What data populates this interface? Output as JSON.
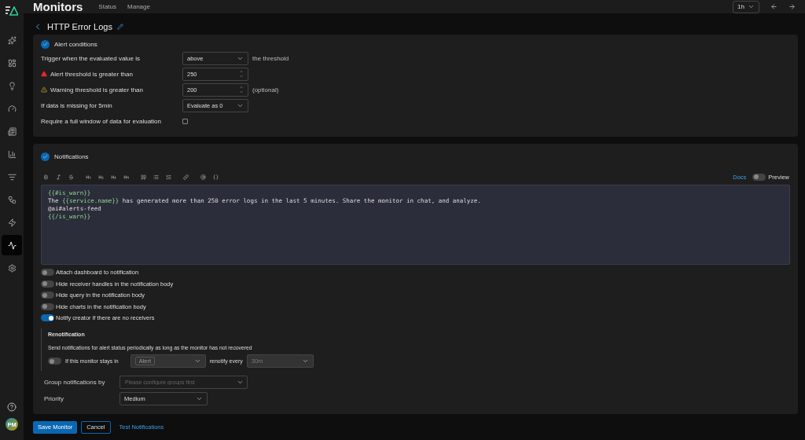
{
  "app": {
    "title": "Monitors",
    "nav": [
      {
        "label": "Status",
        "selected": false
      },
      {
        "label": "Manage",
        "selected": false
      }
    ],
    "time_range": "1h"
  },
  "sidebar": {
    "items": [
      {
        "selected": false
      },
      {
        "selected": false
      },
      {
        "selected": false
      },
      {
        "selected": false
      },
      {
        "selected": false
      },
      {
        "selected": false
      },
      {
        "selected": false
      },
      {
        "selected": false
      },
      {
        "selected": false
      },
      {
        "selected": true
      },
      {
        "selected": false
      }
    ],
    "avatar": "PM"
  },
  "page": {
    "title": "HTTP Error Logs"
  },
  "alert_conditions": {
    "title": "Alert conditions",
    "done": true,
    "rows": [
      {
        "label": "Trigger when the evaluated value is",
        "kind": "select",
        "value": "above",
        "suffix": "the threshold"
      },
      {
        "label": "Alert threshold is greater than",
        "kind": "alert_threshold",
        "value": "250"
      },
      {
        "label": "Warning threshold is greater than",
        "kind": "warning_threshold",
        "value": "200",
        "suffix": "(optional)"
      },
      {
        "label": "If data is missing for 5min",
        "kind": "select",
        "value": "Evaluate as 0"
      },
      {
        "label": "Require a full window of data for evaluation",
        "kind": "checkbox",
        "checked": false
      }
    ]
  },
  "notifications": {
    "title": "Notifications",
    "done": true,
    "docs": "Docs",
    "preview": {
      "label": "Preview",
      "on": false
    },
    "editor_lines": [
      [
        {
          "text": "{{#is_warn}}",
          "kind": "var"
        }
      ],
      [
        {
          "text": "The ",
          "kind": "plain"
        },
        {
          "text": "{{service.name}}",
          "kind": "var"
        },
        {
          "text": " has generated more than 250 error logs in the last 5 minutes. Share the monitor in chat, and analyze.",
          "kind": "plain"
        }
      ],
      [
        {
          "text": "@ai#alerts-feed",
          "kind": "plain"
        }
      ],
      [
        {
          "text": "{{/is_warn}}",
          "kind": "var"
        }
      ]
    ],
    "toggles": [
      {
        "label": "Attach dashboard to notification",
        "on": false
      },
      {
        "label": "Hide receiver handles in the notification body",
        "on": false
      },
      {
        "label": "Hide query in the notification body",
        "on": false
      },
      {
        "label": "Hide charts in the notification body",
        "on": false
      },
      {
        "label": "Notify creator if there are no receivers",
        "on": true
      }
    ],
    "renotification": {
      "title": "Renotification",
      "description": "Send notifications for alert status periodically as long as the monitor has not recovered",
      "on": false,
      "stays_in_label": "If this monitor stays in",
      "status": "Alert",
      "renotify_label": "renotify every",
      "interval": "30m"
    },
    "group_by": {
      "label": "Group notifications by",
      "placeholder": "Please configure groups first"
    },
    "priority": {
      "label": "Priority",
      "value": "Medium"
    }
  },
  "footer": {
    "save": "Save Monitor",
    "cancel": "Cancel",
    "test": "Test Notifications"
  }
}
